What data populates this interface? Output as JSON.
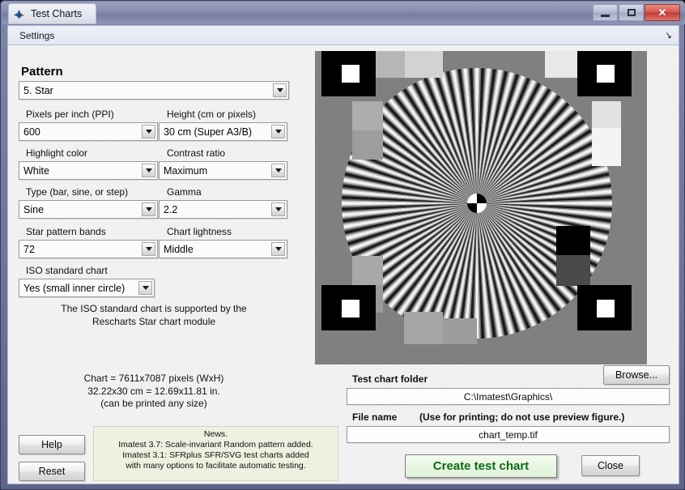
{
  "window": {
    "title": "Test Charts",
    "app_icon": "matlab-icon",
    "minimize_label": "Minimize",
    "maximize_label": "Maximize",
    "close_label": "✕"
  },
  "menubar": {
    "items": [
      "Settings"
    ],
    "dock_arrow": "↘"
  },
  "form": {
    "section_heading": "Pattern",
    "pattern": {
      "label": "",
      "value": "5.    Star",
      "options": [
        "5.    Star"
      ]
    },
    "ppi": {
      "label": "Pixels per inch (PPI)",
      "value": "600",
      "options": [
        "600"
      ]
    },
    "height": {
      "label": "Height (cm or pixels)",
      "value": "30  cm (Super A3/B)",
      "options": [
        "30  cm (Super A3/B)"
      ]
    },
    "highlight_color": {
      "label": "Highlight color",
      "value": "White",
      "options": [
        "White"
      ]
    },
    "contrast_ratio": {
      "label": "Contrast ratio",
      "value": "Maximum",
      "options": [
        "Maximum"
      ]
    },
    "type": {
      "label": "Type (bar, sine, or step)",
      "value": "Sine",
      "options": [
        "Sine"
      ]
    },
    "gamma": {
      "label": "Gamma",
      "value": "2.2",
      "options": [
        "2.2"
      ]
    },
    "star_bands": {
      "label": "Star pattern bands",
      "value": "72",
      "options": [
        "72"
      ]
    },
    "chart_lightness": {
      "label": "Chart lightness",
      "value": "Middle",
      "options": [
        "Middle"
      ]
    },
    "iso_standard": {
      "label": "ISO standard chart",
      "value": "Yes (small inner circle)",
      "options": [
        "Yes (small inner circle)"
      ]
    },
    "iso_note_line1": "The ISO standard chart is supported by the",
    "iso_note_line2": "Rescharts Star chart module"
  },
  "chart_info": {
    "line1": "Chart = 7611x7087 pixels (WxH)",
    "line2": "32.22x30 cm = 12.69x11.81 in.",
    "line3": "(can be printed any size)"
  },
  "news": {
    "line1": "News.",
    "line2": "Imatest 3.7: Scale-invariant Random pattern added.",
    "line3": "Imatest 3.1: SFRplus SFR/SVG test charts added",
    "line4": "with many options to facilitate automatic testing."
  },
  "buttons": {
    "help": "Help",
    "reset": "Reset",
    "browse": "Browse...",
    "create": "Create test chart",
    "close": "Close"
  },
  "output": {
    "folder_label": "Test chart folder",
    "folder_value": "C:\\Imatest\\Graphics\\",
    "filename_label": "File name",
    "filename_note": "(Use for printing; do not use preview figure.)",
    "filename_value": "chart_temp.tif"
  },
  "preview": {
    "name": "star-chart-preview",
    "background_color": "#808080",
    "bands": 72,
    "center_marker": "checker-quadrant-circle",
    "corner_markers": 4
  },
  "colors": {
    "accent_green": "#0a6b14",
    "window_chrome": "#7d84a8",
    "close_red": "#bf3c33",
    "client_bg": "#f0f0f0",
    "news_bg": "#eef0e0"
  }
}
